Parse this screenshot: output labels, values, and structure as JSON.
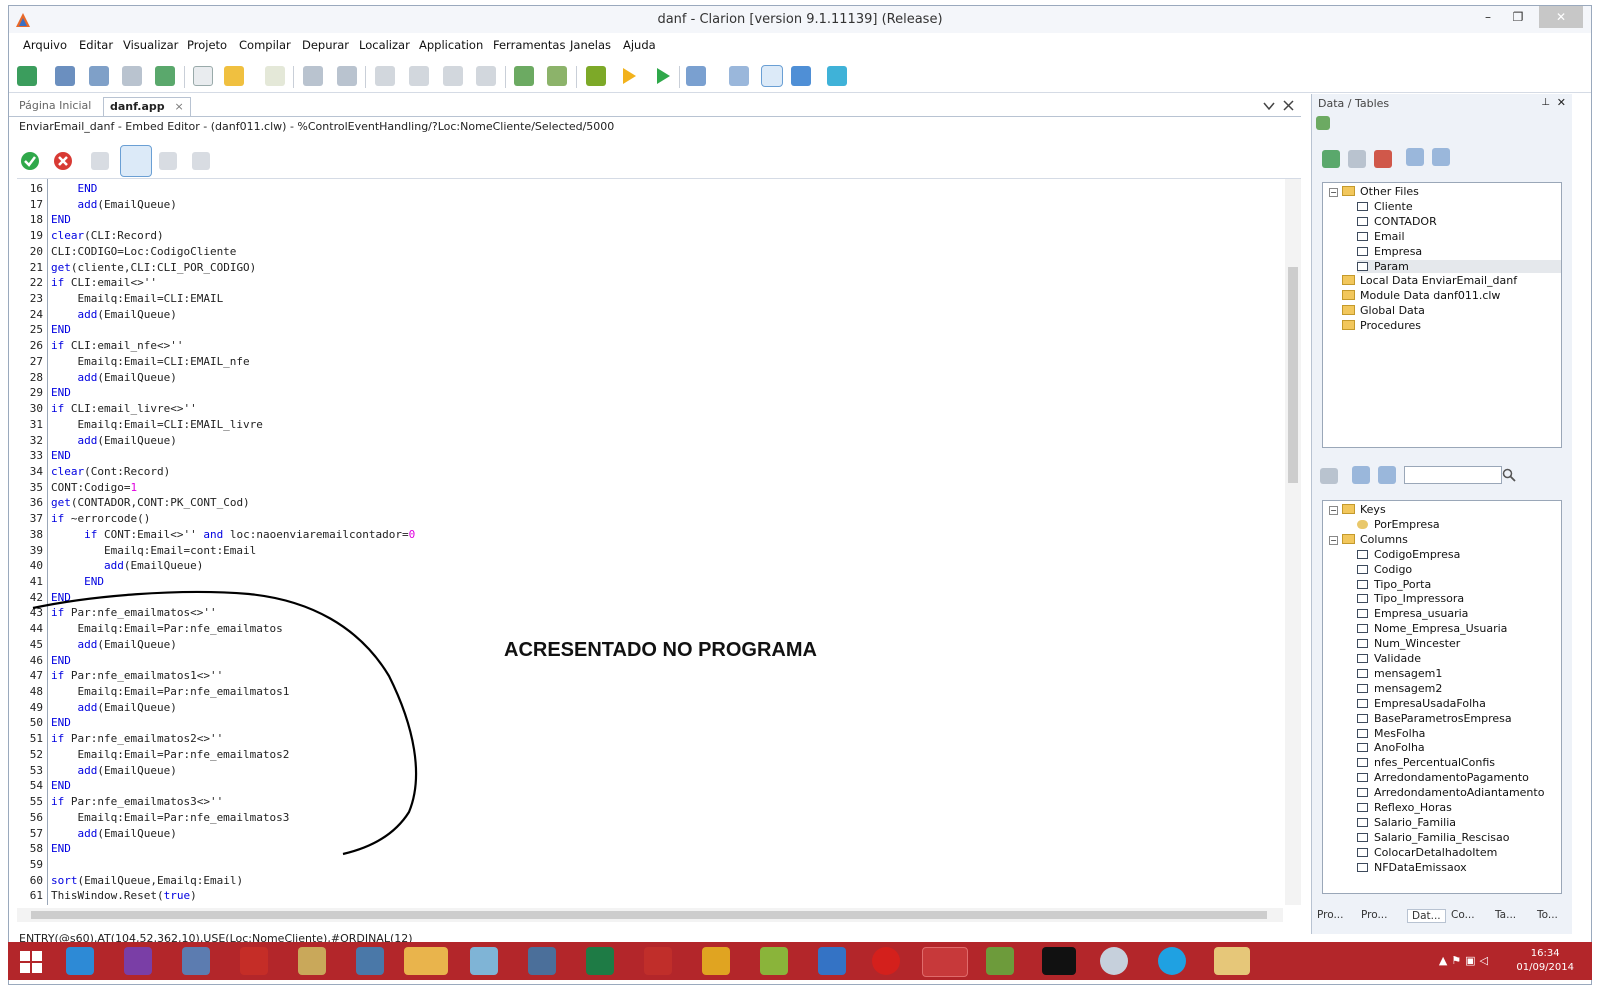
{
  "window": {
    "title": "danf - Clarion [version 9.1.11139] (Release)",
    "minimize": "–",
    "maximize": "❐",
    "close": "✕"
  },
  "menu": [
    "Arquivo",
    "Editar",
    "Visualizar",
    "Projeto",
    "Compilar",
    "Depurar",
    "Localizar",
    "Application",
    "Ferramentas",
    "Janelas",
    "Ajuda"
  ],
  "tabs": {
    "start_page": "Página Inicial",
    "active": "danf.app",
    "active_close": "×"
  },
  "path": "EnviarEmail_danf - Embed Editor - (danf011.clw) - %ControlEventHandling/?Loc:NomeCliente/Selected/5000",
  "code": {
    "first_line": 16,
    "lines": [
      "    END",
      "    add(EmailQueue)",
      "END",
      "clear(CLI:Record)",
      "CLI:CODIGO=Loc:CodigoCliente",
      "get(cliente,CLI:CLI_POR_CODIGO)",
      "if CLI:email<>''",
      "    Emailq:Email=CLI:EMAIL",
      "    add(EmailQueue)",
      "END",
      "if CLI:email_nfe<>''",
      "    Emailq:Email=CLI:EMAIL_nfe",
      "    add(EmailQueue)",
      "END",
      "if CLI:email_livre<>''",
      "    Emailq:Email=CLI:EMAIL_livre",
      "    add(EmailQueue)",
      "END",
      "clear(Cont:Record)",
      "CONT:Codigo=1",
      "get(CONTADOR,CONT:PK_CONT_Cod)",
      "if ~errorcode()",
      "     if CONT:Email<>'' and loc:naoenviaremailcontador=0",
      "        Emailq:Email=cont:Email",
      "        add(EmailQueue)",
      "     END",
      "END",
      "if Par:nfe_emailmatos<>''",
      "    Emailq:Email=Par:nfe_emailmatos",
      "    add(EmailQueue)",
      "END",
      "if Par:nfe_emailmatos1<>''",
      "    Emailq:Email=Par:nfe_emailmatos1",
      "    add(EmailQueue)",
      "END",
      "if Par:nfe_emailmatos2<>''",
      "    Emailq:Email=Par:nfe_emailmatos2",
      "    add(EmailQueue)",
      "END",
      "if Par:nfe_emailmatos3<>''",
      "    Emailq:Email=Par:nfe_emailmatos3",
      "    add(EmailQueue)",
      "END",
      "",
      "sort(EmailQueue,Emailq:Email)",
      "ThisWindow.Reset(true)"
    ]
  },
  "annotation": "ACRESENTADO NO PROGRAMA",
  "status": "ENTRY(@s60),AT(104,52,362,10),USE(Loc:NomeCliente),#ORDINAL(12)",
  "data_panel": {
    "title": "Data / Tables",
    "pin": "⊥",
    "close": "✕",
    "tree": [
      {
        "label": "Other Files",
        "level": 0,
        "kind": "folder",
        "expander": "−"
      },
      {
        "label": "Cliente",
        "level": 1,
        "kind": "table"
      },
      {
        "label": "CONTADOR",
        "level": 1,
        "kind": "table"
      },
      {
        "label": "Email",
        "level": 1,
        "kind": "table"
      },
      {
        "label": "Empresa",
        "level": 1,
        "kind": "table"
      },
      {
        "label": "Param",
        "level": 1,
        "kind": "table",
        "selected": true
      },
      {
        "label": "Local Data EnviarEmail_danf",
        "level": 0,
        "kind": "folder"
      },
      {
        "label": "Module Data danf011.clw",
        "level": 0,
        "kind": "folder"
      },
      {
        "label": "Global Data",
        "level": 0,
        "kind": "folder"
      },
      {
        "label": "Procedures",
        "level": 0,
        "kind": "folder"
      }
    ],
    "fields": [
      {
        "label": "Keys",
        "level": 0,
        "kind": "folder",
        "expander": "−"
      },
      {
        "label": "PorEmpresa",
        "level": 1,
        "kind": "key"
      },
      {
        "label": "Columns",
        "level": 0,
        "kind": "folder",
        "expander": "−"
      },
      {
        "label": "CodigoEmpresa",
        "level": 1,
        "kind": "table"
      },
      {
        "label": "Codigo",
        "level": 1,
        "kind": "table"
      },
      {
        "label": "Tipo_Porta",
        "level": 1,
        "kind": "table"
      },
      {
        "label": "Tipo_Impressora",
        "level": 1,
        "kind": "table"
      },
      {
        "label": "Empresa_usuaria",
        "level": 1,
        "kind": "table"
      },
      {
        "label": "Nome_Empresa_Usuaria",
        "level": 1,
        "kind": "table"
      },
      {
        "label": "Num_Wincester",
        "level": 1,
        "kind": "table"
      },
      {
        "label": "Validade",
        "level": 1,
        "kind": "table"
      },
      {
        "label": "mensagem1",
        "level": 1,
        "kind": "table"
      },
      {
        "label": "mensagem2",
        "level": 1,
        "kind": "table"
      },
      {
        "label": "EmpresaUsadaFolha",
        "level": 1,
        "kind": "table"
      },
      {
        "label": "BaseParametrosEmpresa",
        "level": 1,
        "kind": "table"
      },
      {
        "label": "MesFolha",
        "level": 1,
        "kind": "table"
      },
      {
        "label": "AnoFolha",
        "level": 1,
        "kind": "table"
      },
      {
        "label": "nfes_PercentualConfis",
        "level": 1,
        "kind": "table"
      },
      {
        "label": "ArredondamentoPagamento",
        "level": 1,
        "kind": "table"
      },
      {
        "label": "ArredondamentoAdiantamento",
        "level": 1,
        "kind": "table"
      },
      {
        "label": "Reflexo_Horas",
        "level": 1,
        "kind": "table"
      },
      {
        "label": "Salario_Familia",
        "level": 1,
        "kind": "table"
      },
      {
        "label": "Salario_Familia_Rescisao",
        "level": 1,
        "kind": "table"
      },
      {
        "label": "ColocarDetalhadoItem",
        "level": 1,
        "kind": "table"
      },
      {
        "label": "NFDataEmissaox",
        "level": 1,
        "kind": "table"
      }
    ],
    "search_placeholder": "",
    "bottom_tabs": [
      "Pro...",
      "Pro...",
      "Dat...",
      "Co...",
      "Ta...",
      "To..."
    ],
    "active_bottom_tab": "Dat..."
  },
  "taskbar": {
    "time": "16:34",
    "date": "01/09/2014"
  },
  "colors": {
    "keyword": "#0000e0",
    "number": "#e000e0",
    "taskbar": "#b3262a"
  }
}
